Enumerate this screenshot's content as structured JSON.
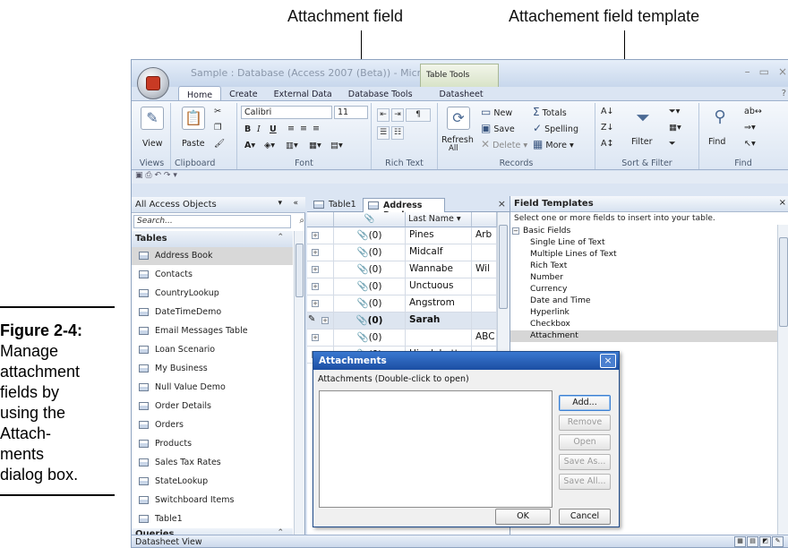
{
  "callouts": {
    "attachment_field": "Attachment field",
    "template": "Attachement field template"
  },
  "figure": {
    "label": "Figure 2-4:",
    "caption_lines": [
      "Manage",
      "attachment",
      "fields by",
      "using the",
      "Attach-",
      "ments",
      "dialog box."
    ]
  },
  "window": {
    "title": "Sample : Database (Access 2007 (Beta)) - Micr...",
    "context_tab": "Table Tools",
    "controls": [
      "–",
      "▭",
      "×"
    ],
    "tabs": [
      "Home",
      "Create",
      "External Data",
      "Database Tools",
      "Datasheet"
    ],
    "active_tab": "Home",
    "help": "?"
  },
  "ribbon": {
    "groups": {
      "views": "Views",
      "clipboard": "Clipboard",
      "font": "Font",
      "richtext": "Rich Text",
      "records": "Records",
      "sortfilter": "Sort & Filter",
      "find": "Find"
    },
    "view": "View",
    "paste": "Paste",
    "font_name": "Calibri",
    "font_size": "11",
    "bold": "B",
    "italic": "I",
    "underline": "U",
    "refresh": "Refresh",
    "refresh_sub": "All",
    "new": "New",
    "save": "Save",
    "delete": "Delete",
    "totals": "Totals",
    "spelling": "Spelling",
    "more": "More",
    "filter": "Filter",
    "find": "Find"
  },
  "nav": {
    "header": "All Access Objects",
    "search_placeholder": "Search...",
    "section_tables": "Tables",
    "tables": [
      "Address Book",
      "Contacts",
      "CountryLookup",
      "DateTimeDemo",
      "Email Messages Table",
      "Loan Scenario",
      "My Business",
      "Null Value Demo",
      "Order Details",
      "Orders",
      "Products",
      "Sales Tax Rates",
      "StateLookup",
      "Switchboard Items",
      "Table1"
    ],
    "selected_table": "Address Book",
    "section_queries": "Queries"
  },
  "doc_tabs": {
    "tab1": "Table1",
    "tab2": "Address Book",
    "close": "×"
  },
  "grid": {
    "headers": {
      "attach": "📎",
      "last_name": "Last Name ▾",
      "next": ""
    },
    "rows": [
      {
        "attach": "📎(0)",
        "last": "Pines",
        "next": "Arb"
      },
      {
        "attach": "📎(0)",
        "last": "Midcalf",
        "next": ""
      },
      {
        "attach": "📎(0)",
        "last": "Wannabe",
        "next": "Wil"
      },
      {
        "attach": "📎(0)",
        "last": "Unctuous",
        "next": ""
      },
      {
        "attach": "📎(0)",
        "last": "Angstrom",
        "next": ""
      },
      {
        "attach": "📎(0)",
        "last": "Sarah",
        "next": ""
      },
      {
        "attach": "📎(0)",
        "last": "",
        "next": "ABC"
      },
      {
        "attach": "📎(0)",
        "last": "Higglebotton",
        "next": ""
      }
    ]
  },
  "field_templates": {
    "title": "Field Templates",
    "close": "×",
    "subtitle": "Select one or more fields to insert into your table.",
    "category": "Basic Fields",
    "items": [
      "Single Line of Text",
      "Multiple Lines of Text",
      "Rich Text",
      "Number",
      "Currency",
      "Date and Time",
      "Hyperlink",
      "Checkbox",
      "Attachment"
    ],
    "selected": "Attachment"
  },
  "dialog": {
    "title": "Attachments",
    "label": "Attachments (Double-click to open)",
    "buttons": {
      "add": "Add...",
      "remove": "Remove",
      "open": "Open",
      "save_as": "Save As...",
      "save_all": "Save All..."
    },
    "ok": "OK",
    "cancel": "Cancel",
    "close": "×"
  },
  "status": {
    "text": "Datasheet View"
  },
  "colors": {
    "accent": "#1c4fa3",
    "ribbon": "#dbe5f3",
    "title_text": "#8a97aa"
  }
}
